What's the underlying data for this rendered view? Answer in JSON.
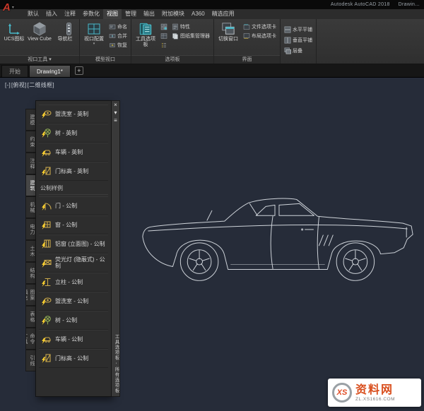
{
  "titlebar": {
    "logo": "A",
    "app_title": "Autodesk AutoCAD 2018",
    "doc_title": "Drawin...",
    "menu_tabs": [
      "默认",
      "插入",
      "注释",
      "参数化",
      "视图",
      "管理",
      "输出",
      "附加模块",
      "A360",
      "精选应用"
    ],
    "active_tab": "视图"
  },
  "ribbon": {
    "groups": [
      {
        "label": "视口工具",
        "arrow": true,
        "large": [
          {
            "label": "UCS图标",
            "icon": "ucs"
          },
          {
            "label": "View Cube",
            "icon": "cube"
          },
          {
            "label": "导航栏",
            "icon": "navbar"
          }
        ]
      },
      {
        "label": "模型视口",
        "large": [
          {
            "label": "视口配置",
            "icon": "viewport",
            "arrow": true
          }
        ],
        "small": [
          {
            "label": "命名",
            "icon": "named"
          },
          {
            "label": "合并",
            "icon": "join"
          },
          {
            "label": "恢复",
            "icon": "restore"
          }
        ]
      },
      {
        "label": "选项板",
        "large": [
          {
            "label": "工具选项板",
            "icon": "palette"
          }
        ],
        "minis": [
          "blocks",
          "propgrid",
          "count"
        ],
        "small": [
          {
            "label": "特性",
            "icon": "props"
          },
          {
            "label": "图纸集管理器",
            "icon": "sheetset"
          }
        ]
      },
      {
        "label": "界面",
        "large": [
          {
            "label": "切换窗口",
            "icon": "switch"
          }
        ],
        "small": [
          {
            "label": "文件选项卡",
            "icon": "filetabs"
          },
          {
            "label": "布局选项卡",
            "icon": "layouttabs"
          }
        ]
      },
      {
        "label": "",
        "stack": [
          {
            "label": "水平平铺",
            "icon": "tileh"
          },
          {
            "label": "垂直平铺",
            "icon": "tilev"
          },
          {
            "label": "层叠",
            "icon": "cascade"
          }
        ]
      }
    ]
  },
  "file_tabs": {
    "tabs": [
      {
        "label": "开始",
        "active": false
      },
      {
        "label": "Drawing1*",
        "active": true
      }
    ],
    "new_tab_label": "+"
  },
  "viewport": {
    "controls": [
      "[-]",
      "[俯视]",
      "[二维线框]"
    ]
  },
  "palette": {
    "side_tabs": [
      "建模",
      "约束",
      "注释",
      "建筑",
      "机械",
      "电力",
      "土木",
      "结构",
      "图案填充",
      "表格",
      "命令工具",
      "引线"
    ],
    "active_side_tab": "建筑",
    "items_imperial": [
      {
        "label": "盥洗室 - 英制",
        "icon": "washroom"
      },
      {
        "label": "树 - 英制",
        "icon": "tree"
      },
      {
        "label": "车辆 - 英制",
        "icon": "vehicle"
      },
      {
        "label": "门标高 - 英制",
        "icon": "doorelev"
      }
    ],
    "section_header": "公制样例",
    "items_metric": [
      {
        "label": "门 - 公制",
        "icon": "door"
      },
      {
        "label": "窗 - 公制",
        "icon": "window"
      },
      {
        "label": "铝窗 (立面图) - 公制",
        "icon": "alum"
      },
      {
        "label": "荧光灯 (隐蔽式) - 公制",
        "icon": "light"
      },
      {
        "label": "立柱 - 公制",
        "icon": "column"
      },
      {
        "label": "盥洗室 - 公制",
        "icon": "washroom"
      },
      {
        "label": "树 - 公制",
        "icon": "tree"
      },
      {
        "label": "车辆 - 公制",
        "icon": "vehicle"
      },
      {
        "label": "门标高 - 公制",
        "icon": "doorelev"
      }
    ],
    "title_vertical": "工具选项板 - 所有选项板"
  },
  "watermark": {
    "circle_text": "XS",
    "brand": "资料网",
    "url": "ZL.XS1616.COM"
  }
}
